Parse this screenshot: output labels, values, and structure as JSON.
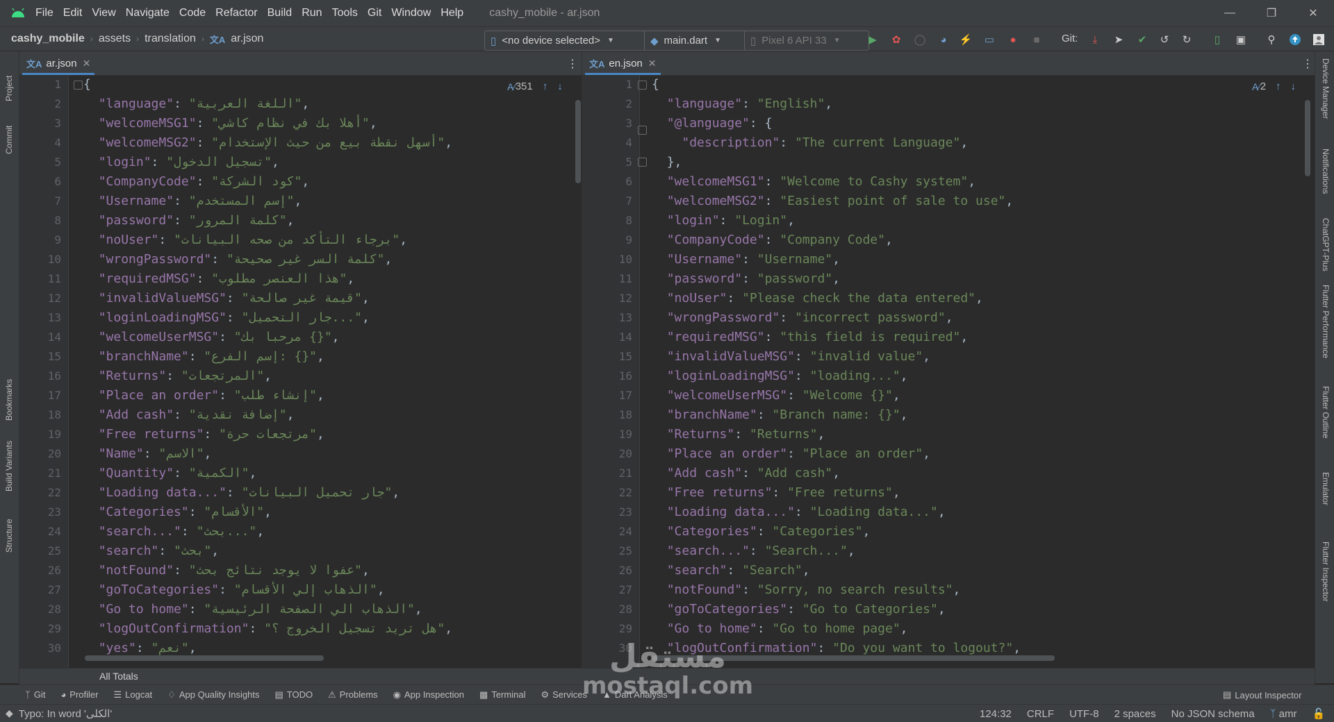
{
  "window": {
    "title": "cashy_mobile - ar.json",
    "menu": [
      "File",
      "Edit",
      "View",
      "Navigate",
      "Code",
      "Refactor",
      "Build",
      "Run",
      "Tools",
      "Git",
      "Window",
      "Help"
    ]
  },
  "navbar": {
    "breadcrumb": [
      "cashy_mobile",
      "assets",
      "translation",
      "ar.json"
    ],
    "device_combo": "<no device selected>",
    "run_config": "main.dart",
    "emulator": "Pixel 6 API 33",
    "git_label": "Git:"
  },
  "left_tools": [
    "Project",
    "Commit",
    "Bookmarks",
    "Build Variants",
    "Structure"
  ],
  "right_tools": [
    "Device Manager",
    "Notifications",
    "ChatGPT-Plus",
    "Flutter Performance",
    "Flutter Outline",
    "Emulator",
    "Flutter Inspector"
  ],
  "left_editor": {
    "tab": "ar.json",
    "match_count": "351",
    "lines": [
      [
        "{"
      ],
      [
        "\"language\"",
        "\"اللغة العربية\""
      ],
      [
        "\"welcomeMSG1\"",
        "\"أهلا بك في نظام كاشي\""
      ],
      [
        "\"welcomeMSG2\"",
        "\"أسهل نقطة بيع من حيث الإستخدام\""
      ],
      [
        "\"login\"",
        "\"تسجيل الدخول\""
      ],
      [
        "\"CompanyCode\"",
        "\"كود الشركة\""
      ],
      [
        "\"Username\"",
        "\"إسم المستخدم\""
      ],
      [
        "\"password\"",
        "\"كلمة المرور\""
      ],
      [
        "\"noUser\"",
        "\"برجاء التأكد من صحه البيانات\""
      ],
      [
        "\"wrongPassword\"",
        "\"كلمة السر غير صحيحة\""
      ],
      [
        "\"requiredMSG\"",
        "\"هذا العنصر مطلوب\""
      ],
      [
        "\"invalidValueMSG\"",
        "\"قيمة غير صالحة\""
      ],
      [
        "\"loginLoadingMSG\"",
        "\"جار التحميل...\""
      ],
      [
        "\"welcomeUserMSG\"",
        "\"مرحبا بك {}\""
      ],
      [
        "\"branchName\"",
        "\"إسم الفرع: {}\""
      ],
      [
        "\"Returns\"",
        "\"المرتجعات\""
      ],
      [
        "\"Place an order\"",
        "\"إنشاء طلب\""
      ],
      [
        "\"Add cash\"",
        "\"إضافة نقدية\""
      ],
      [
        "\"Free returns\"",
        "\"مرتجعات حرة\""
      ],
      [
        "\"Name\"",
        "\"الاسم\""
      ],
      [
        "\"Quantity\"",
        "\"الكمية\""
      ],
      [
        "\"Loading data...\"",
        "\"جار تحميل البيانات\""
      ],
      [
        "\"Categories\"",
        "\"الأقسام\""
      ],
      [
        "\"search...\"",
        "\"بحث...\""
      ],
      [
        "\"search\"",
        "\"بحث\""
      ],
      [
        "\"notFound\"",
        "\"عفوا لا يوجد نتائج بحث\""
      ],
      [
        "\"goToCategories\"",
        "\"الذهاب إلي الأقسام\""
      ],
      [
        "\"Go to home\"",
        "\"الذهاب الي الصفحة الرئيسية\""
      ],
      [
        "\"logOutConfirmation\"",
        "\"هل تريد تسجيل الخروج ؟\""
      ],
      [
        "\"yes\"",
        "\"نعم\""
      ]
    ]
  },
  "right_editor": {
    "tab": "en.json",
    "match_count": "2",
    "lines": [
      [
        "{"
      ],
      [
        "\"language\"",
        "\"English\""
      ],
      [
        "\"@language\"",
        "{"
      ],
      [
        "\"description\"",
        "\"The current Language\""
      ],
      [
        "},"
      ],
      [
        "\"welcomeMSG1\"",
        "\"Welcome to Cashy system\""
      ],
      [
        "\"welcomeMSG2\"",
        "\"Easiest point of sale to use\""
      ],
      [
        "\"login\"",
        "\"Login\""
      ],
      [
        "\"CompanyCode\"",
        "\"Company Code\""
      ],
      [
        "\"Username\"",
        "\"Username\""
      ],
      [
        "\"password\"",
        "\"password\""
      ],
      [
        "\"noUser\"",
        "\"Please check the data entered\""
      ],
      [
        "\"wrongPassword\"",
        "\"incorrect password\""
      ],
      [
        "\"requiredMSG\"",
        "\"this field is required\""
      ],
      [
        "\"invalidValueMSG\"",
        "\"invalid value\""
      ],
      [
        "\"loginLoadingMSG\"",
        "\"loading...\""
      ],
      [
        "\"welcomeUserMSG\"",
        "\"Welcome {}\""
      ],
      [
        "\"branchName\"",
        "\"Branch name: {}\""
      ],
      [
        "\"Returns\"",
        "\"Returns\""
      ],
      [
        "\"Place an order\"",
        "\"Place an order\""
      ],
      [
        "\"Add cash\"",
        "\"Add cash\""
      ],
      [
        "\"Free returns\"",
        "\"Free returns\""
      ],
      [
        "\"Loading data...\"",
        "\"Loading data...\""
      ],
      [
        "\"Categories\"",
        "\"Categories\""
      ],
      [
        "\"search...\"",
        "\"Search...\""
      ],
      [
        "\"search\"",
        "\"Search\""
      ],
      [
        "\"notFound\"",
        "\"Sorry, no search results\""
      ],
      [
        "\"goToCategories\"",
        "\"Go to Categories\""
      ],
      [
        "\"Go to home\"",
        "\"Go to home page\""
      ],
      [
        "\"logOutConfirmation\"",
        "\"Do you want to logout?\""
      ]
    ]
  },
  "totals_label": "All Totals",
  "bottom_tools": [
    "Git",
    "Profiler",
    "Logcat",
    "App Quality Insights",
    "TODO",
    "Problems",
    "App Inspection",
    "Terminal",
    "Services",
    "Dart Analysis"
  ],
  "layout_inspector": "Layout Inspector",
  "status": {
    "message": "Typo: In word 'الكلى'",
    "position": "124:32",
    "line_sep": "CRLF",
    "encoding": "UTF-8",
    "indent": "2 spaces",
    "schema": "No JSON schema",
    "branch": "amr"
  },
  "watermark": {
    "top": "مستقل",
    "bottom": "mostaql.com"
  }
}
